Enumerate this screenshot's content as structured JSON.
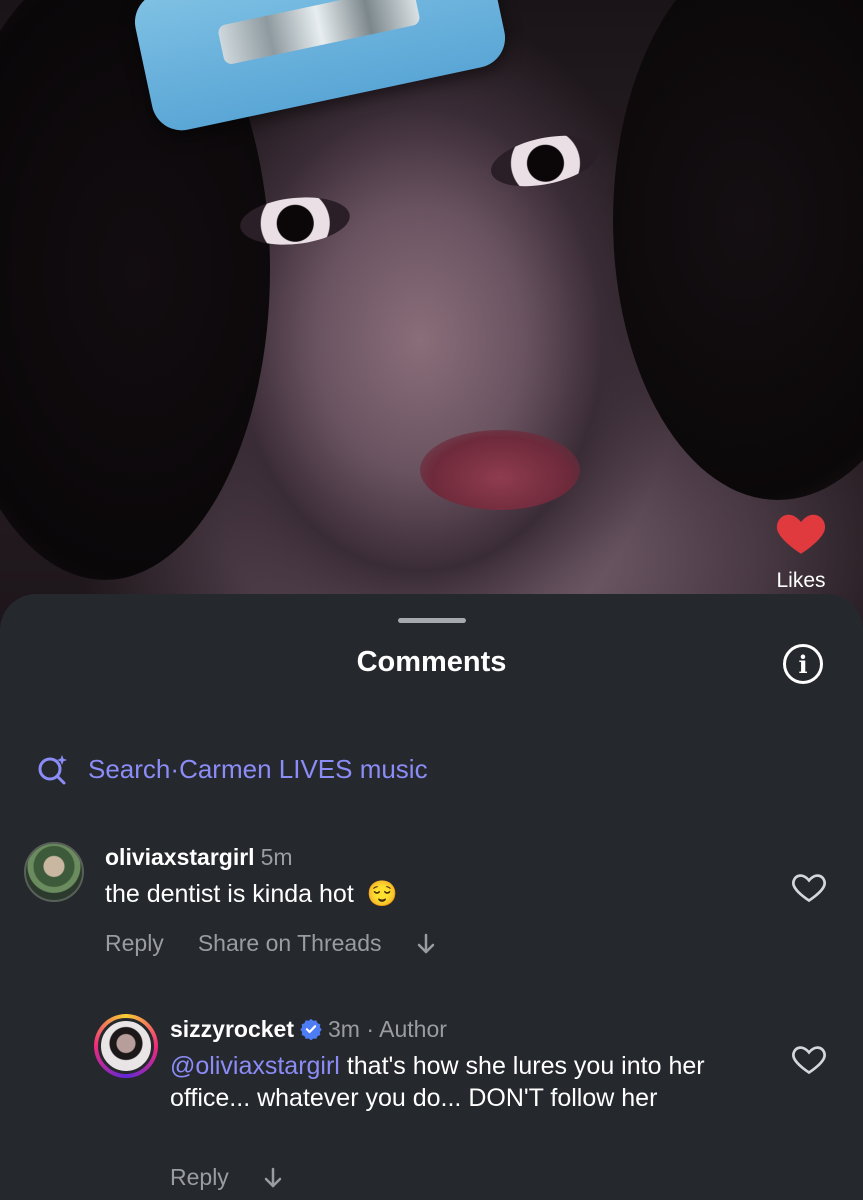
{
  "video": {
    "likes_label": "Likes",
    "like_color": "#e0393e"
  },
  "sheet": {
    "title": "Comments",
    "search": {
      "prefix": "Search",
      "separator": " · ",
      "query": "Carmen LIVES music",
      "accent": "#8b8cf6"
    }
  },
  "comments": [
    {
      "username": "oliviaxstargirl",
      "time": "5m",
      "text": "the dentist is kinda hot",
      "emoji": "😌",
      "actions": {
        "reply": "Reply",
        "share": "Share on Threads"
      }
    },
    {
      "username": "sizzyrocket",
      "verified": true,
      "time": "3m · Author",
      "mention": "@oliviaxstargirl",
      "text": " that's how she lures you into her office... whatever you do... DON'T follow her",
      "actions": {
        "reply": "Reply"
      }
    }
  ]
}
